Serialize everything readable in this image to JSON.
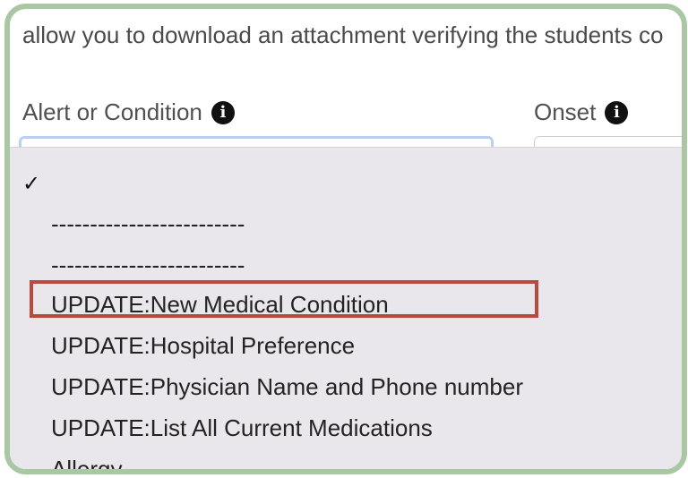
{
  "intro": {
    "text": "allow you to download an attachment verifying the students co"
  },
  "fields": {
    "alert_label": "Alert or Condition",
    "onset_label": "Onset",
    "info_icon": "i"
  },
  "dropdown": {
    "check_mark": "✓",
    "options": [
      "-------------------------",
      "-------------------------",
      "UPDATE:New Medical Condition",
      "UPDATE:Hospital Preference",
      "UPDATE:Physician Name and Phone number",
      "UPDATE:List All Current Medications",
      "Allergy"
    ]
  },
  "colors": {
    "frame_border": "#a9c7a2",
    "highlight_border": "#b94a3e",
    "dropdown_bg": "#e9e7ec"
  }
}
